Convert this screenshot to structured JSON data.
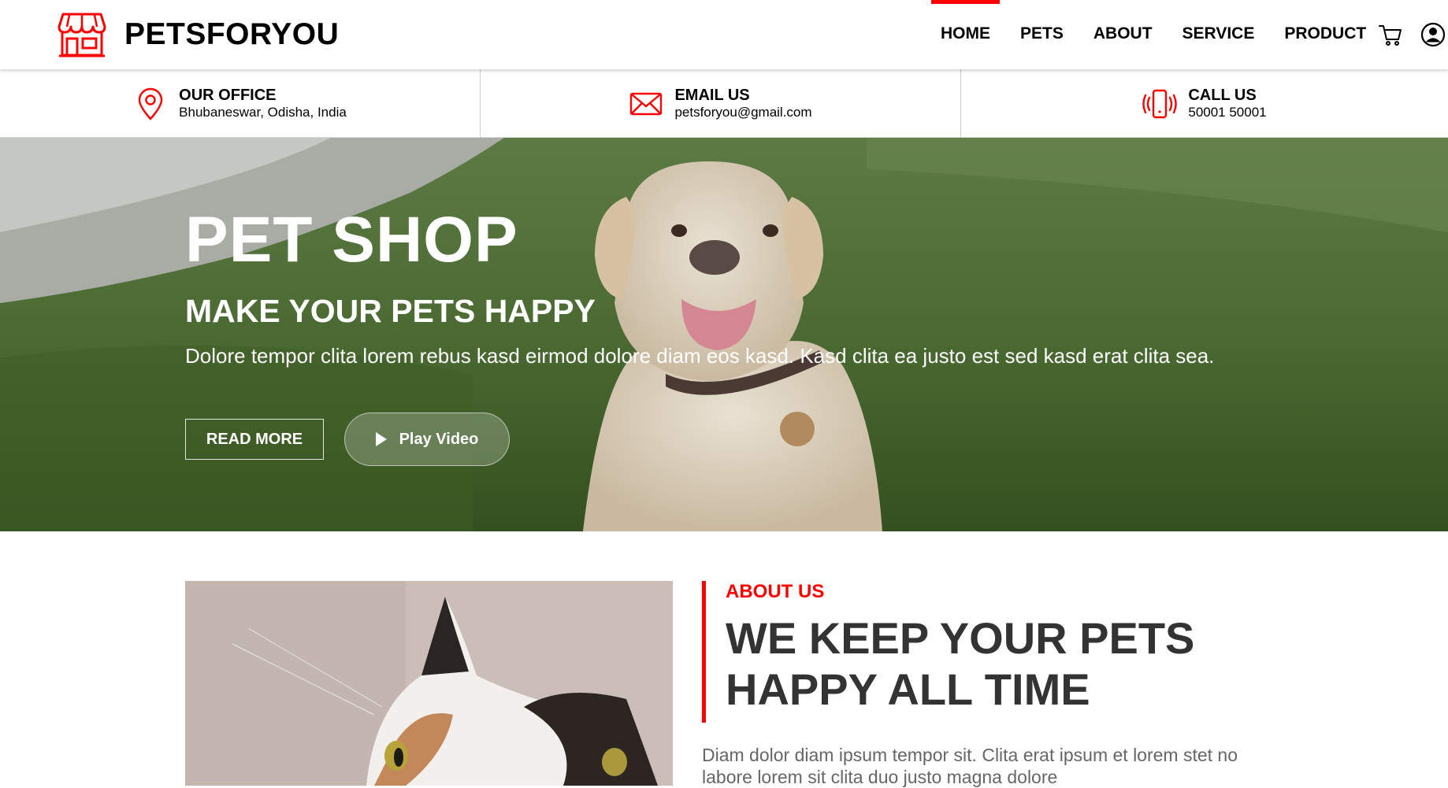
{
  "brand": {
    "name": "PETSFORYOU",
    "icon": "storefront-icon",
    "accent": "#ff0000"
  },
  "nav": {
    "items": [
      {
        "label": "HOME",
        "active": true
      },
      {
        "label": "PETS",
        "active": false
      },
      {
        "label": "ABOUT",
        "active": false
      },
      {
        "label": "SERVICE",
        "active": false
      },
      {
        "label": "PRODUCT",
        "active": false
      }
    ],
    "icons": [
      "cart-icon",
      "user-account-icon"
    ]
  },
  "info": [
    {
      "icon": "map-pin-icon",
      "title": "OUR OFFICE",
      "value": "Bhubaneswar, Odisha, India"
    },
    {
      "icon": "envelope-icon",
      "title": "EMAIL US",
      "value": "petsforyou@gmail.com"
    },
    {
      "icon": "phone-ringing-icon",
      "title": "CALL US",
      "value": "50001 50001"
    }
  ],
  "hero": {
    "title": "PET SHOP",
    "subtitle": "MAKE YOUR PETS HAPPY",
    "text": "Dolore tempor clita lorem rebus kasd eirmod dolore diam eos kasd. Kasd clita ea justo est sed kasd erat clita sea.",
    "read_more": "READ MORE",
    "play_video": "Play Video"
  },
  "about": {
    "label": "ABOUT US",
    "heading_line1": "WE KEEP YOUR PETS",
    "heading_line2": "HAPPY ALL TIME",
    "text": "Diam dolor diam ipsum tempor sit. Clita erat ipsum et lorem stet no labore lorem sit clita duo justo magna dolore"
  }
}
